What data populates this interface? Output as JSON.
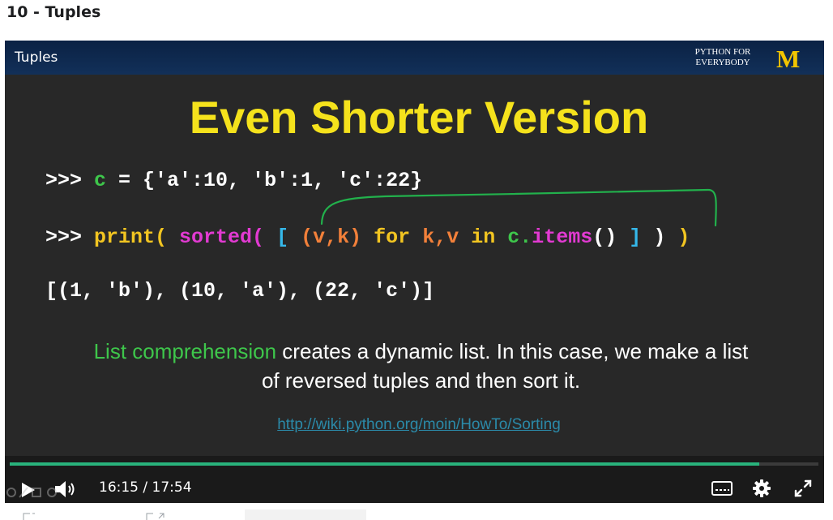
{
  "page": {
    "title": "10 - Tuples"
  },
  "slide": {
    "header_title": "Tuples",
    "brand_line_1": "PYTHON FOR",
    "brand_line_2": "EVERYBODY",
    "brand_logo": "M",
    "heading": "Even Shorter Version",
    "code_line_1": [
      {
        "text": ">>> ",
        "color": "white"
      },
      {
        "text": "c",
        "color": "green"
      },
      {
        "text": " = {'a':10, 'b':1, 'c':22}",
        "color": "white"
      }
    ],
    "code_line_2": [
      {
        "text": ">>> ",
        "color": "white"
      },
      {
        "text": "print(",
        "color": "yellow"
      },
      {
        "text": " ",
        "color": "white"
      },
      {
        "text": "sorted(",
        "color": "magenta"
      },
      {
        "text": " ",
        "color": "white"
      },
      {
        "text": "[",
        "color": "cyan"
      },
      {
        "text": " ",
        "color": "white"
      },
      {
        "text": "(v,k)",
        "color": "orange"
      },
      {
        "text": " ",
        "color": "white"
      },
      {
        "text": "for",
        "color": "yellow"
      },
      {
        "text": " ",
        "color": "white"
      },
      {
        "text": "k,v",
        "color": "orange"
      },
      {
        "text": " ",
        "color": "white"
      },
      {
        "text": "in",
        "color": "yellow"
      },
      {
        "text": " ",
        "color": "white"
      },
      {
        "text": "c.",
        "color": "green"
      },
      {
        "text": "items",
        "color": "magenta"
      },
      {
        "text": "() ",
        "color": "white"
      },
      {
        "text": "]",
        "color": "cyan"
      },
      {
        "text": " ) ",
        "color": "white"
      },
      {
        "text": ")",
        "color": "yellow"
      }
    ],
    "code_line_3": "[(1, 'b'), (10, 'a'), (22, 'c')]",
    "explanation_highlight": "List comprehension",
    "explanation_rest": " creates a dynamic list. In this case, we make a list of reversed tuples and then sort it.",
    "link": "http://wiki.python.org/moin/HowTo/Sorting"
  },
  "player": {
    "current_time": "16:15",
    "separator": "/",
    "duration": "17:54",
    "progress_fraction": 0.9265,
    "icons": [
      "play-icon",
      "volume-icon",
      "captions-icon",
      "settings-icon",
      "fullscreen-icon"
    ]
  },
  "colors": {
    "heading": "#f5e21c",
    "green": "#3ec64b",
    "yellow": "#f2c521",
    "magenta": "#e23ad2",
    "orange": "#f2803a",
    "cyan": "#35b8ea",
    "white": "#ffffff",
    "link": "#2b8aa9",
    "progress": "#29b37c",
    "header_bg": "#123059",
    "logo": "#f2c500"
  }
}
